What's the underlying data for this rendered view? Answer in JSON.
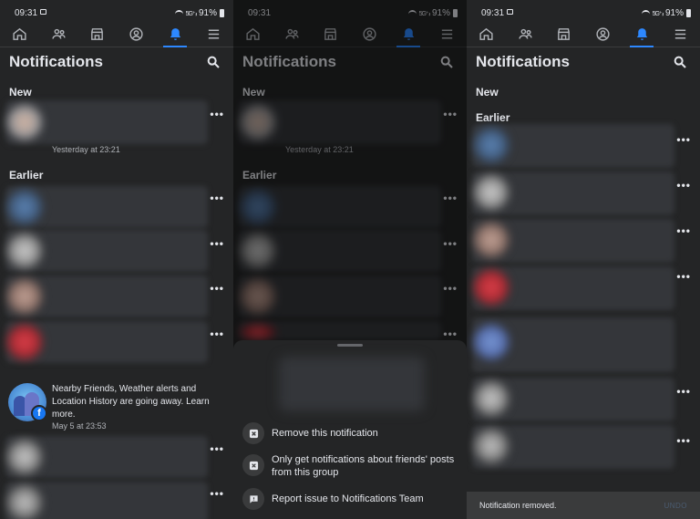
{
  "status": {
    "time": "09:31",
    "battery": "91%",
    "signal": "5G⁺ ᵢₗₗ"
  },
  "header": {
    "title": "Notifications"
  },
  "tabs": [
    "home",
    "friends",
    "marketplace",
    "profile",
    "notifications",
    "menu"
  ],
  "sections": {
    "new": "New",
    "earlier": "Earlier"
  },
  "notifications": {
    "new_timestamp": "Yesterday at 23:21",
    "nearby": {
      "text": "Nearby Friends, Weather alerts and Location History are going away. Learn more.",
      "timestamp": "May 5 at 23:53"
    },
    "more_label": "•••"
  },
  "sheet": {
    "items": [
      {
        "label": "Remove this notification",
        "icon": "close-box-icon"
      },
      {
        "label": "Only get notifications about friends' posts from this group",
        "icon": "group-box-icon"
      },
      {
        "label": "Report issue to Notifications Team",
        "icon": "report-flag-icon"
      }
    ]
  },
  "toast": {
    "message": "Notification removed.",
    "action": "UNDO"
  },
  "colors": {
    "background": "#242526",
    "accent": "#2d88ff",
    "text": "#e4e6eb",
    "muted": "#b0b3b8"
  }
}
